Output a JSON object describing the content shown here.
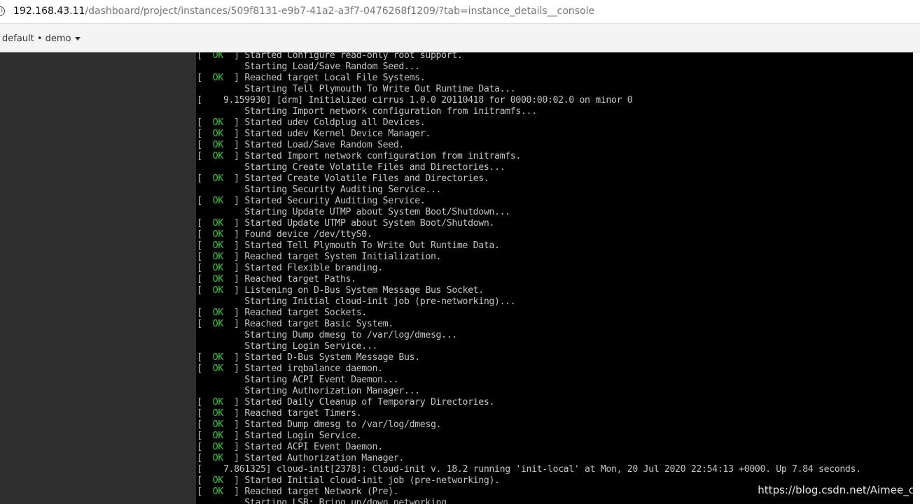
{
  "address_bar": {
    "host": "192.168.43.11",
    "path": "/dashboard/project/instances/509f8131-e9b7-41a2-a3f7-0476268f1209/?tab=instance_details__console"
  },
  "header": {
    "project_selector": "default • demo"
  },
  "console": {
    "ok_text": "OK",
    "lines": [
      {
        "s": "ok",
        "t": "Started Configure read-only root support."
      },
      {
        "s": "",
        "t": "Starting Load/Save Random Seed..."
      },
      {
        "s": "ok",
        "t": "Reached target Local File Systems."
      },
      {
        "s": "",
        "t": "Starting Tell Plymouth To Write Out Runtime Data..."
      },
      {
        "s": "raw",
        "t": "[    9.159930] [drm] Initialized cirrus 1.0.0 20110418 for 0000:00:02.0 on minor 0"
      },
      {
        "s": "",
        "t": "Starting Import network configuration from initramfs..."
      },
      {
        "s": "ok",
        "t": "Started udev Coldplug all Devices."
      },
      {
        "s": "ok",
        "t": "Started udev Kernel Device Manager."
      },
      {
        "s": "ok",
        "t": "Started Load/Save Random Seed."
      },
      {
        "s": "ok",
        "t": "Started Import network configuration from initramfs."
      },
      {
        "s": "",
        "t": "Starting Create Volatile Files and Directories..."
      },
      {
        "s": "ok",
        "t": "Started Create Volatile Files and Directories."
      },
      {
        "s": "",
        "t": "Starting Security Auditing Service..."
      },
      {
        "s": "ok",
        "t": "Started Security Auditing Service."
      },
      {
        "s": "",
        "t": "Starting Update UTMP about System Boot/Shutdown..."
      },
      {
        "s": "ok",
        "t": "Started Update UTMP about System Boot/Shutdown."
      },
      {
        "s": "ok",
        "t": "Found device /dev/ttyS0."
      },
      {
        "s": "ok",
        "t": "Started Tell Plymouth To Write Out Runtime Data."
      },
      {
        "s": "ok",
        "t": "Reached target System Initialization."
      },
      {
        "s": "ok",
        "t": "Started Flexible branding."
      },
      {
        "s": "ok",
        "t": "Reached target Paths."
      },
      {
        "s": "ok",
        "t": "Listening on D-Bus System Message Bus Socket."
      },
      {
        "s": "",
        "t": "Starting Initial cloud-init job (pre-networking)..."
      },
      {
        "s": "ok",
        "t": "Reached target Sockets."
      },
      {
        "s": "ok",
        "t": "Reached target Basic System."
      },
      {
        "s": "",
        "t": "Starting Dump dmesg to /var/log/dmesg..."
      },
      {
        "s": "",
        "t": "Starting Login Service..."
      },
      {
        "s": "ok",
        "t": "Started D-Bus System Message Bus."
      },
      {
        "s": "ok",
        "t": "Started irqbalance daemon."
      },
      {
        "s": "",
        "t": "Starting ACPI Event Daemon..."
      },
      {
        "s": "",
        "t": "Starting Authorization Manager..."
      },
      {
        "s": "ok",
        "t": "Started Daily Cleanup of Temporary Directories."
      },
      {
        "s": "ok",
        "t": "Reached target Timers."
      },
      {
        "s": "ok",
        "t": "Started Dump dmesg to /var/log/dmesg."
      },
      {
        "s": "ok",
        "t": "Started Login Service."
      },
      {
        "s": "ok",
        "t": "Started ACPI Event Daemon."
      },
      {
        "s": "ok",
        "t": "Started Authorization Manager."
      },
      {
        "s": "raw",
        "t": "[    7.861325] cloud-init[2378]: Cloud-init v. 18.2 running 'init-local' at Mon, 20 Jul 2020 22:54:13 +0000. Up 7.84 seconds."
      },
      {
        "s": "ok",
        "t": "Started Initial cloud-init job (pre-networking)."
      },
      {
        "s": "ok",
        "t": "Reached target Network (Pre)."
      },
      {
        "s": "",
        "t": "Starting LSB: Bring up/down networking..."
      }
    ]
  },
  "watermark": "https://blog.csdn.net/Aimee_c"
}
